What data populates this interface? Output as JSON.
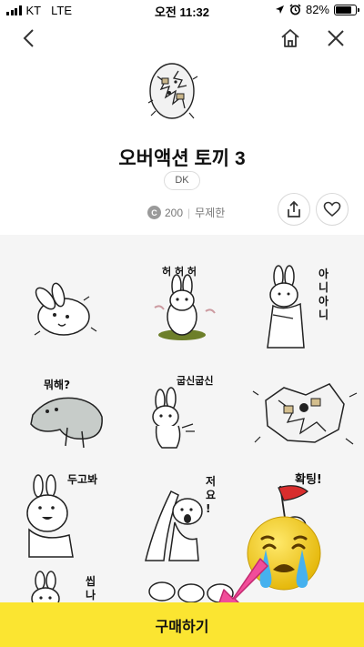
{
  "status_bar": {
    "carrier": "KT",
    "network": "LTE",
    "time": "오전 11:32",
    "battery_percent": "82%",
    "battery_level": 0.82
  },
  "nav": {
    "back_icon": "chevron-left-icon",
    "home_icon": "home-icon",
    "close_icon": "close-icon"
  },
  "product": {
    "title": "오버액션 토끼 3",
    "author": "DK",
    "coin_symbol": "C",
    "price": "200",
    "limit": "무제한"
  },
  "actions": {
    "share_icon": "share-icon",
    "like_icon": "heart-icon"
  },
  "stickers": {
    "s2_text": "허 허 허",
    "s3_text": "아 니 아 니",
    "s4_text": "뭐해?",
    "s5_text": "굽신굽신",
    "s7_text": "두고봐",
    "s8_text": "저 요 !",
    "s9_text": "확팅!",
    "s10_text": "씹 나"
  },
  "buy": {
    "label": "구매하기"
  },
  "colors": {
    "buy_bar": "#fbe531",
    "grid_bg": "#f5f5f5",
    "emoji": "#f7d21d",
    "arrow": "#f14d9a"
  }
}
